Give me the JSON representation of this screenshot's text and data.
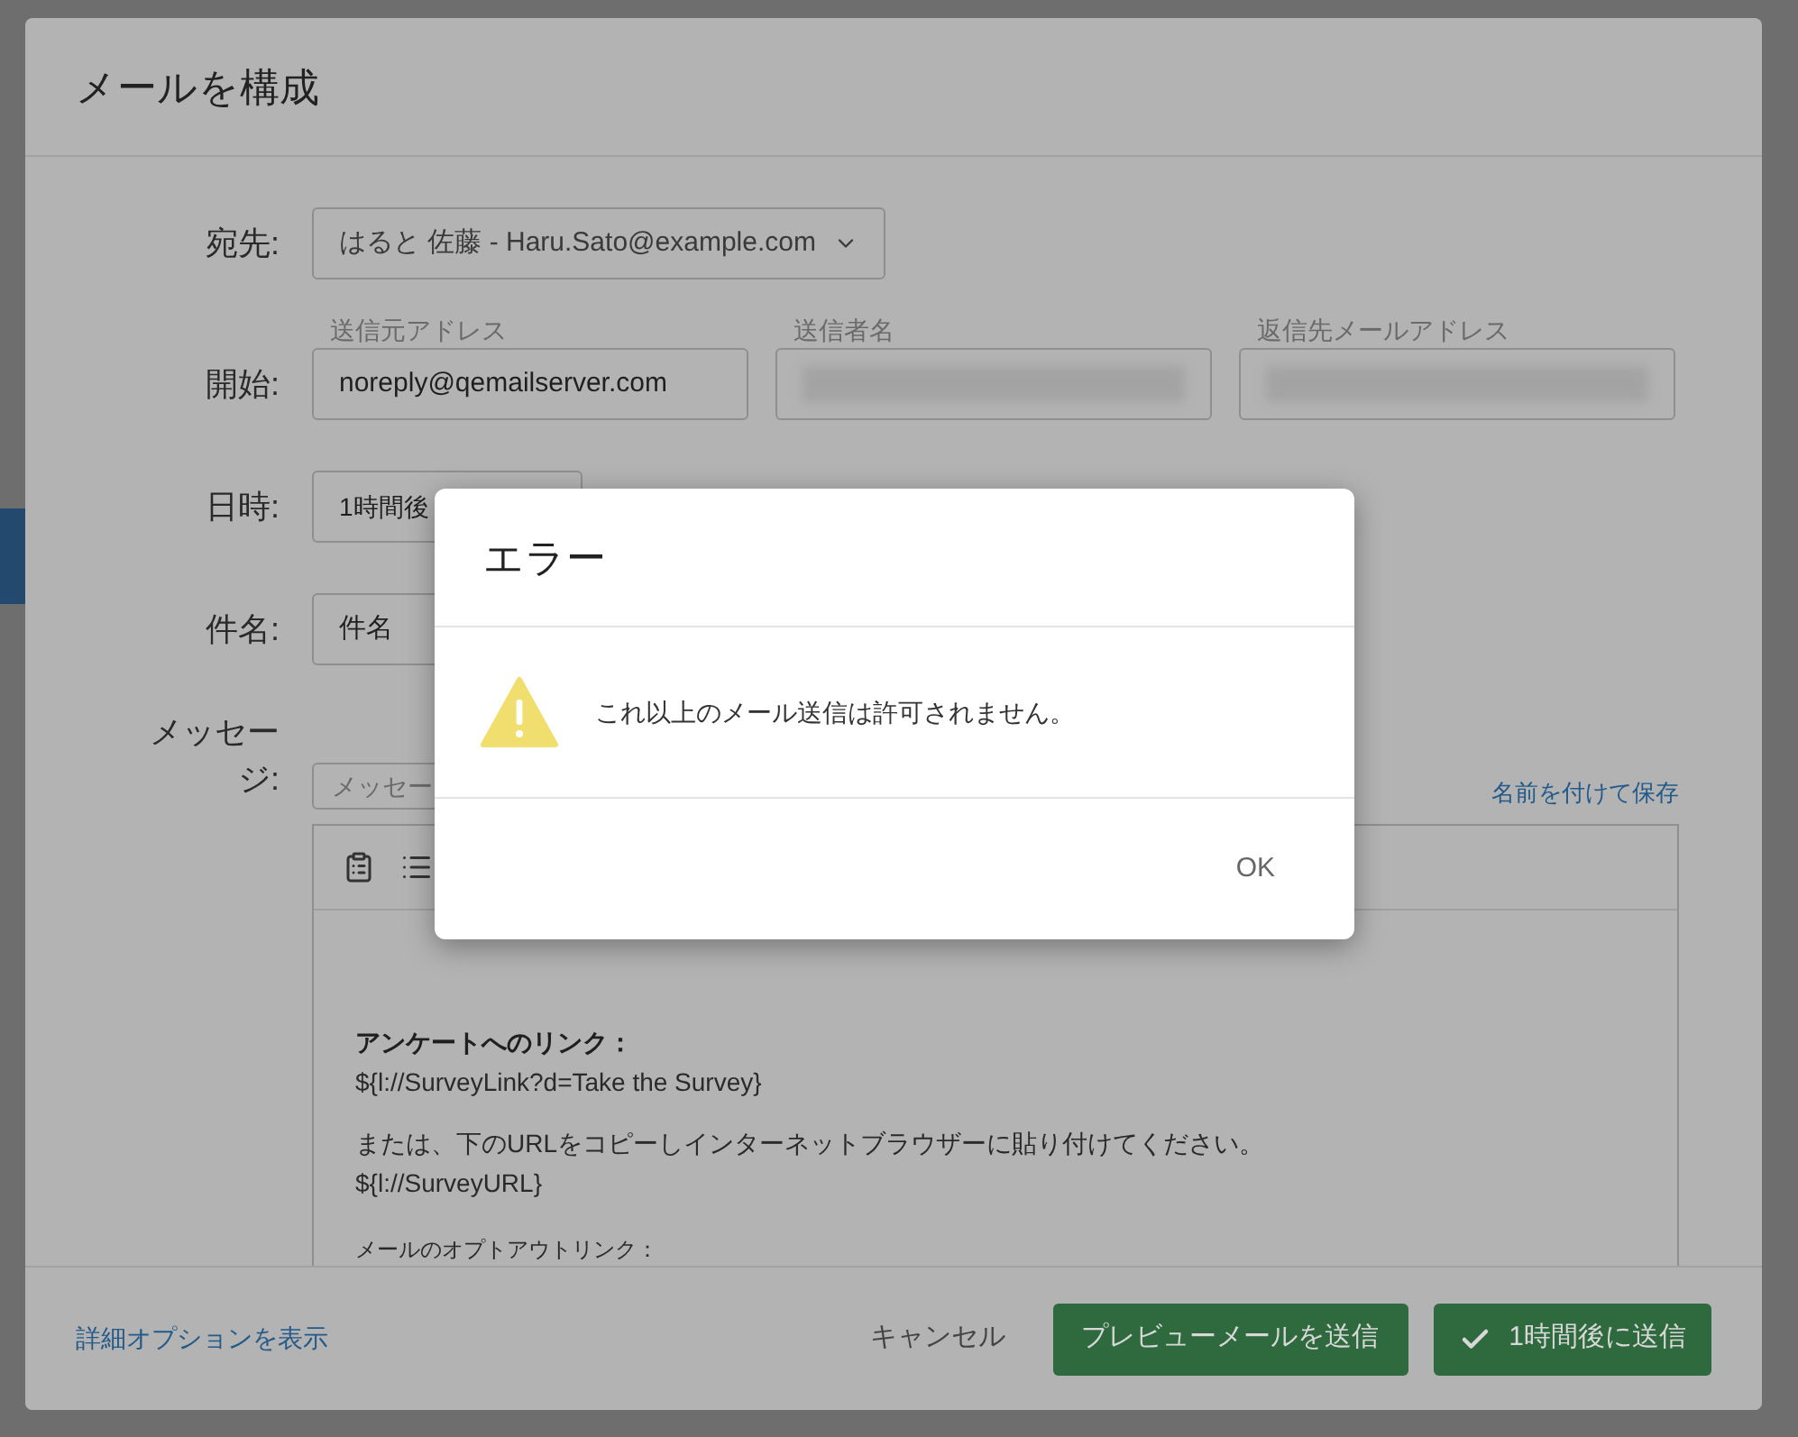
{
  "compose": {
    "title": "メールを構成",
    "recipient": {
      "label": "宛先:",
      "value": "はると 佐藤 - Haru.Sato@example.com"
    },
    "from": {
      "label": "開始:",
      "inputs": [
        {
          "caption": "送信元アドレス",
          "value": "noreply@qemailserver.com",
          "redacted": false
        },
        {
          "caption": "送信者名",
          "redacted": true
        },
        {
          "caption": "返信先メールアドレス",
          "redacted": true
        }
      ]
    },
    "schedule": {
      "label": "日時:",
      "value": "1時間後"
    },
    "subject": {
      "label": "件名:",
      "value": "件名"
    },
    "message": {
      "label_lines": [
        "メッセー",
        "ジ:"
      ],
      "template": "メッセー",
      "save_link": "名前を付けて保存",
      "blocks": [
        {
          "lines": [
            {
              "kind": "heading",
              "text": "アンケートへのリンク："
            },
            {
              "kind": "text",
              "text": "${l://SurveyLink?d=Take the Survey}"
            }
          ]
        },
        {
          "lines": [
            {
              "kind": "text",
              "text": "または、下のURLをコピーしインターネットブラウザーに貼り付けてください。"
            },
            {
              "kind": "text",
              "text": "${l://SurveyURL}"
            }
          ]
        },
        {
          "lines": [
            {
              "kind": "note",
              "text": "メールのオプトアウトリンク："
            }
          ]
        }
      ]
    },
    "footer": {
      "advanced_link": "詳細オプションを表示",
      "cancel": "キャンセル",
      "preview": "プレビューメールを送信",
      "send": "1時間後に送信"
    }
  },
  "error": {
    "title": "エラー",
    "message": "これ以上のメール送信は許可されません。",
    "ok": "OK"
  }
}
